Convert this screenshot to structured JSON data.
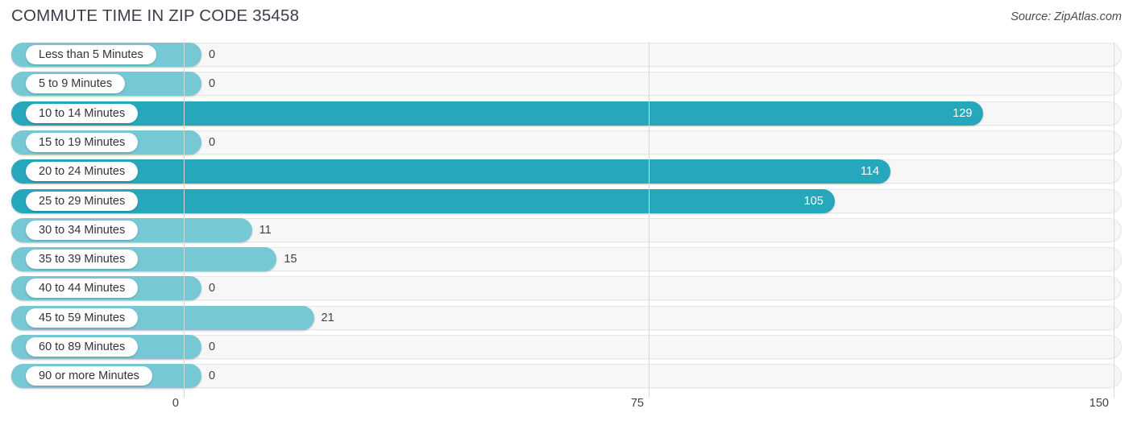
{
  "header": {
    "title": "COMMUTE TIME IN ZIP CODE 35458",
    "source": "Source: ZipAtlas.com"
  },
  "colors": {
    "bar_dark": "#27a7bc",
    "bar_light": "#76c8d4",
    "track": "#f7f7f7",
    "gridline": "#d8d8d8",
    "text": "#3c3c4a"
  },
  "chart_data": {
    "type": "bar",
    "orientation": "horizontal",
    "title": "COMMUTE TIME IN ZIP CODE 35458",
    "xlabel": "",
    "ylabel": "",
    "xlim": [
      0,
      150
    ],
    "grid": true,
    "legend": "none",
    "axis_ticks": [
      {
        "label": "0",
        "value": 0
      },
      {
        "label": "75",
        "value": 75
      },
      {
        "label": "150",
        "value": 150
      }
    ],
    "categories": [
      "Less than 5 Minutes",
      "5 to 9 Minutes",
      "10 to 14 Minutes",
      "15 to 19 Minutes",
      "20 to 24 Minutes",
      "25 to 29 Minutes",
      "30 to 34 Minutes",
      "35 to 39 Minutes",
      "40 to 44 Minutes",
      "45 to 59 Minutes",
      "60 to 89 Minutes",
      "90 or more Minutes"
    ],
    "values": [
      0,
      0,
      129,
      0,
      114,
      105,
      11,
      15,
      0,
      21,
      0,
      0
    ],
    "value_labels": [
      "0",
      "0",
      "129",
      "0",
      "114",
      "105",
      "11",
      "15",
      "0",
      "21",
      "0",
      "0"
    ]
  },
  "rows": [
    {
      "label": "Less than 5 Minutes",
      "value": 0,
      "value_label": "0",
      "shade": "light",
      "label_inside": false
    },
    {
      "label": "5 to 9 Minutes",
      "value": 0,
      "value_label": "0",
      "shade": "light",
      "label_inside": false
    },
    {
      "label": "10 to 14 Minutes",
      "value": 129,
      "value_label": "129",
      "shade": "dark",
      "label_inside": true
    },
    {
      "label": "15 to 19 Minutes",
      "value": 0,
      "value_label": "0",
      "shade": "light",
      "label_inside": false
    },
    {
      "label": "20 to 24 Minutes",
      "value": 114,
      "value_label": "114",
      "shade": "dark",
      "label_inside": true
    },
    {
      "label": "25 to 29 Minutes",
      "value": 105,
      "value_label": "105",
      "shade": "dark",
      "label_inside": true
    },
    {
      "label": "30 to 34 Minutes",
      "value": 11,
      "value_label": "11",
      "shade": "light",
      "label_inside": false
    },
    {
      "label": "35 to 39 Minutes",
      "value": 15,
      "value_label": "15",
      "shade": "light",
      "label_inside": false
    },
    {
      "label": "40 to 44 Minutes",
      "value": 0,
      "value_label": "0",
      "shade": "light",
      "label_inside": false
    },
    {
      "label": "45 to 59 Minutes",
      "value": 21,
      "value_label": "21",
      "shade": "light",
      "label_inside": false
    },
    {
      "label": "60 to 89 Minutes",
      "value": 0,
      "value_label": "0",
      "shade": "light",
      "label_inside": false
    },
    {
      "label": "90 or more Minutes",
      "value": 0,
      "value_label": "0",
      "shade": "light",
      "label_inside": false
    }
  ]
}
